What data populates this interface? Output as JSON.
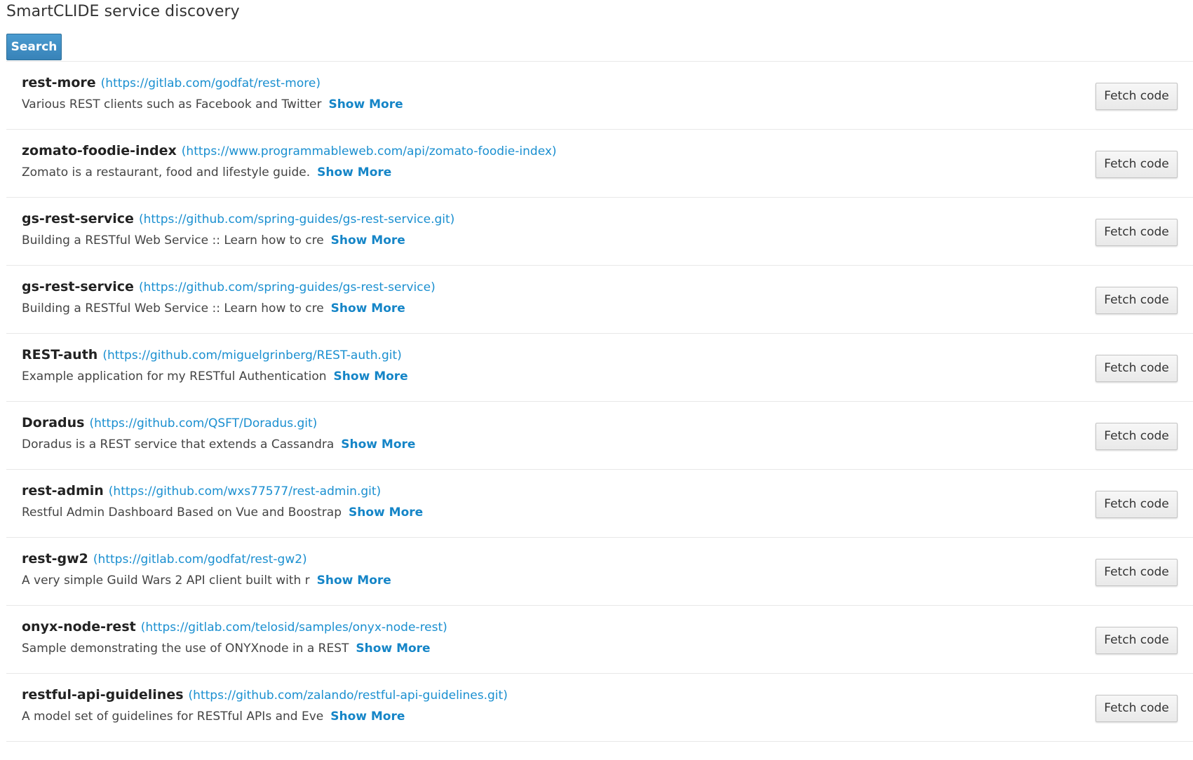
{
  "page": {
    "title": "SmartCLIDE service discovery",
    "search_label": "Search"
  },
  "results": [
    {
      "name": "rest-more",
      "url": "(https://gitlab.com/godfat/rest-more)",
      "description": "Various REST clients such as Facebook and Twitter",
      "show_more": "Show More",
      "fetch_label": "Fetch code"
    },
    {
      "name": "zomato-foodie-index",
      "url": "(https://www.programmableweb.com/api/zomato-foodie-index)",
      "description": "Zomato is a restaurant, food and lifestyle guide.",
      "show_more": "Show More",
      "fetch_label": "Fetch code"
    },
    {
      "name": "gs-rest-service",
      "url": "(https://github.com/spring-guides/gs-rest-service.git)",
      "description": "Building a RESTful Web Service :: Learn how to cre",
      "show_more": "Show More",
      "fetch_label": "Fetch code"
    },
    {
      "name": "gs-rest-service",
      "url": "(https://github.com/spring-guides/gs-rest-service)",
      "description": "Building a RESTful Web Service :: Learn how to cre",
      "show_more": "Show More",
      "fetch_label": "Fetch code"
    },
    {
      "name": "REST-auth",
      "url": "(https://github.com/miguelgrinberg/REST-auth.git)",
      "description": "Example application for my RESTful Authentication",
      "show_more": "Show More",
      "fetch_label": "Fetch code"
    },
    {
      "name": "Doradus",
      "url": "(https://github.com/QSFT/Doradus.git)",
      "description": "Doradus is a REST service that extends a Cassandra",
      "show_more": "Show More",
      "fetch_label": "Fetch code"
    },
    {
      "name": "rest-admin",
      "url": "(https://github.com/wxs77577/rest-admin.git)",
      "description": "Restful Admin Dashboard Based on Vue and Boostrap",
      "show_more": "Show More",
      "fetch_label": "Fetch code"
    },
    {
      "name": "rest-gw2",
      "url": "(https://gitlab.com/godfat/rest-gw2)",
      "description": "A very simple Guild Wars 2 API client built with r",
      "show_more": "Show More",
      "fetch_label": "Fetch code"
    },
    {
      "name": "onyx-node-rest",
      "url": "(https://gitlab.com/telosid/samples/onyx-node-rest)",
      "description": "Sample demonstrating the use of ONYXnode in a REST",
      "show_more": "Show More",
      "fetch_label": "Fetch code"
    },
    {
      "name": "restful-api-guidelines",
      "url": "(https://github.com/zalando/restful-api-guidelines.git)",
      "description": "A model set of guidelines for RESTful APIs and Eve",
      "show_more": "Show More",
      "fetch_label": "Fetch code"
    }
  ],
  "colors": {
    "link": "#1a8fd0",
    "search_button": "#3f8fc4",
    "divider": "#e8e8e8"
  }
}
